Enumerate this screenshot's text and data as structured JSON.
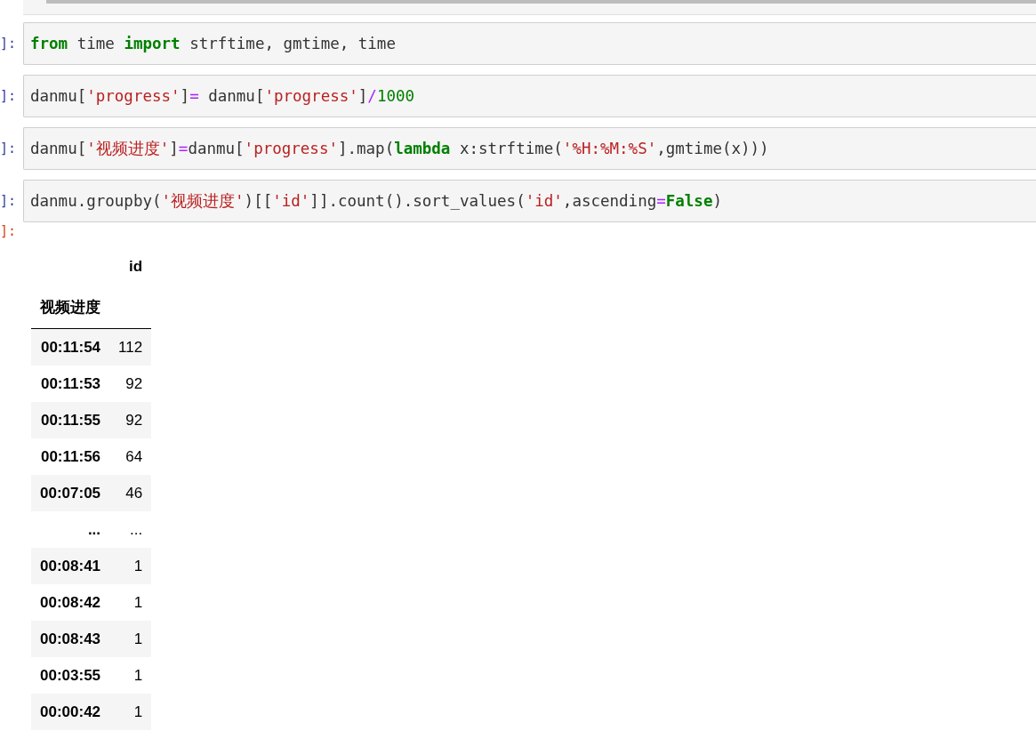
{
  "cells": [
    {
      "prompt": "]:",
      "code": [
        {
          "kind": "kw",
          "text": "from"
        },
        {
          "kind": "plain",
          "text": " time "
        },
        {
          "kind": "kw",
          "text": "import"
        },
        {
          "kind": "plain",
          "text": " strftime, gmtime, time"
        }
      ]
    },
    {
      "prompt": "]:",
      "code": [
        {
          "kind": "plain",
          "text": "danmu["
        },
        {
          "kind": "str",
          "text": "'progress'"
        },
        {
          "kind": "plain",
          "text": "]"
        },
        {
          "kind": "op",
          "text": "="
        },
        {
          "kind": "plain",
          "text": " danmu["
        },
        {
          "kind": "str",
          "text": "'progress'"
        },
        {
          "kind": "plain",
          "text": "]"
        },
        {
          "kind": "op",
          "text": "/"
        },
        {
          "kind": "num",
          "text": "1000"
        }
      ]
    },
    {
      "prompt": "]:",
      "code": [
        {
          "kind": "plain",
          "text": "danmu["
        },
        {
          "kind": "str",
          "text": "'视频进度'"
        },
        {
          "kind": "plain",
          "text": "]"
        },
        {
          "kind": "op",
          "text": "="
        },
        {
          "kind": "plain",
          "text": "danmu["
        },
        {
          "kind": "str",
          "text": "'progress'"
        },
        {
          "kind": "plain",
          "text": "].map("
        },
        {
          "kind": "kw",
          "text": "lambda"
        },
        {
          "kind": "plain",
          "text": " x:strftime("
        },
        {
          "kind": "str",
          "text": "'%H:%M:%S'"
        },
        {
          "kind": "plain",
          "text": ",gmtime(x)))"
        }
      ]
    },
    {
      "prompt": "]:",
      "code": [
        {
          "kind": "plain",
          "text": "danmu.groupby("
        },
        {
          "kind": "str",
          "text": "'视频进度'"
        },
        {
          "kind": "plain",
          "text": ")[["
        },
        {
          "kind": "str",
          "text": "'id'"
        },
        {
          "kind": "plain",
          "text": "]].count().sort_values("
        },
        {
          "kind": "str",
          "text": "'id'"
        },
        {
          "kind": "plain",
          "text": ",ascending"
        },
        {
          "kind": "op",
          "text": "="
        },
        {
          "kind": "kw",
          "text": "False"
        },
        {
          "kind": "plain",
          "text": ")"
        }
      ]
    }
  ],
  "output": {
    "prompt": "]:",
    "table": {
      "columns": [
        "id"
      ],
      "index_name": "视频进度",
      "rows": [
        {
          "index": "00:11:54",
          "value": "112"
        },
        {
          "index": "00:11:53",
          "value": "92"
        },
        {
          "index": "00:11:55",
          "value": "92"
        },
        {
          "index": "00:11:56",
          "value": "64"
        },
        {
          "index": "00:07:05",
          "value": "46"
        },
        {
          "index": "...",
          "value": "..."
        },
        {
          "index": "00:08:41",
          "value": "1"
        },
        {
          "index": "00:08:42",
          "value": "1"
        },
        {
          "index": "00:08:43",
          "value": "1"
        },
        {
          "index": "00:03:55",
          "value": "1"
        },
        {
          "index": "00:00:42",
          "value": "1"
        }
      ]
    }
  }
}
